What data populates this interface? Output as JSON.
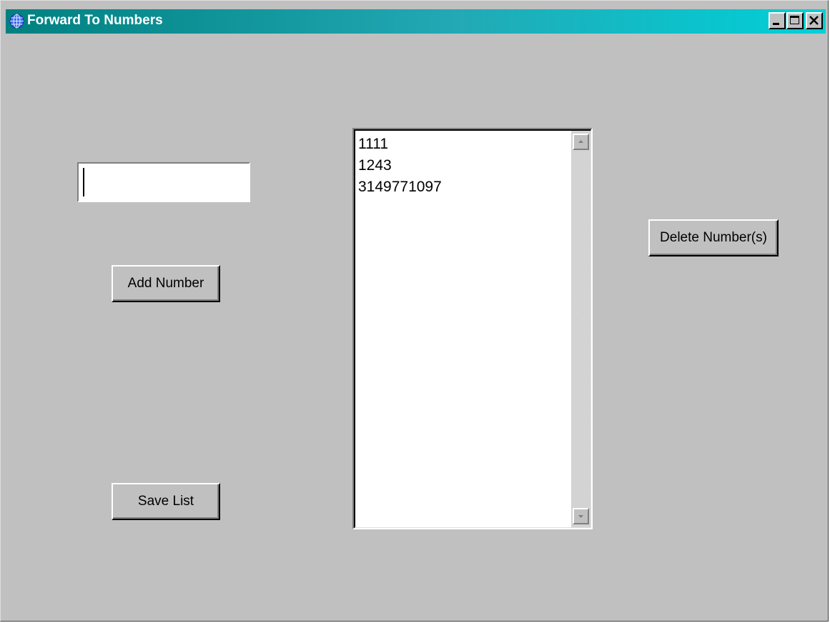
{
  "window": {
    "title": "Forward To Numbers",
    "icon": "globe-icon",
    "controls": [
      "minimize-icon",
      "maximize-icon",
      "close-icon"
    ]
  },
  "number_input": {
    "value": "",
    "placeholder": ""
  },
  "buttons": {
    "add_label": "Add Number",
    "save_label": "Save List",
    "delete_label": "Delete Number(s)"
  },
  "numbers_list": {
    "items": [
      "1111",
      "1243",
      "3149771097"
    ]
  },
  "colors": {
    "titlebar_start": "#008080",
    "titlebar_end": "#00d0d8",
    "face": "#c0c0c0"
  }
}
